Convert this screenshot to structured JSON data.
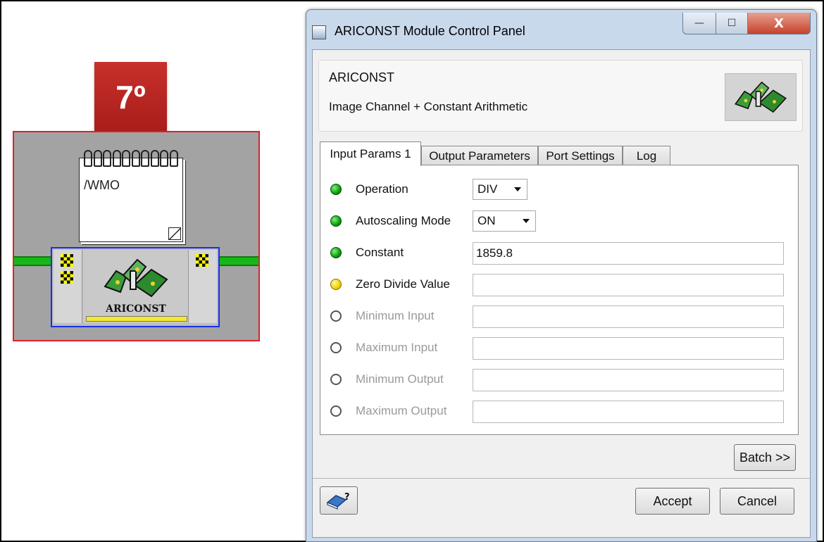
{
  "step_badge": "7º",
  "diagram": {
    "note_text": "/WMO",
    "module_name": "ARICONST"
  },
  "window": {
    "title": "ARICONST Module Control Panel",
    "minimize": "—",
    "maximize": "☐",
    "close": "X"
  },
  "header": {
    "name": "ARICONST",
    "description": "Image Channel + Constant Arithmetic"
  },
  "tabs": [
    {
      "label": "Input Params 1",
      "active": true
    },
    {
      "label": "Output Parameters",
      "active": false
    },
    {
      "label": "Port Settings",
      "active": false
    },
    {
      "label": "Log",
      "active": false
    }
  ],
  "params": [
    {
      "label": "Operation",
      "status": "green",
      "type": "select",
      "value": "DIV"
    },
    {
      "label": "Autoscaling Mode",
      "status": "green",
      "type": "select",
      "value": "ON"
    },
    {
      "label": "Constant",
      "status": "green",
      "type": "text",
      "value": "1859.8"
    },
    {
      "label": "Zero Divide Value",
      "status": "yellow",
      "type": "text",
      "value": ""
    },
    {
      "label": "Minimum Input",
      "status": "empty",
      "type": "text",
      "value": ""
    },
    {
      "label": "Maximum Input",
      "status": "empty",
      "type": "text",
      "value": ""
    },
    {
      "label": "Minimum Output",
      "status": "empty",
      "type": "text",
      "value": ""
    },
    {
      "label": "Maximum Output",
      "status": "empty",
      "type": "text",
      "value": ""
    }
  ],
  "buttons": {
    "batch": "Batch >>",
    "accept": "Accept",
    "cancel": "Cancel"
  },
  "colors": {
    "badge": "#b52420",
    "module_border": "#e0202a",
    "node_border": "#1a2ee6",
    "pipe": "#18b718",
    "status_green": "#0b9a0b",
    "status_yellow": "#f0d000"
  }
}
